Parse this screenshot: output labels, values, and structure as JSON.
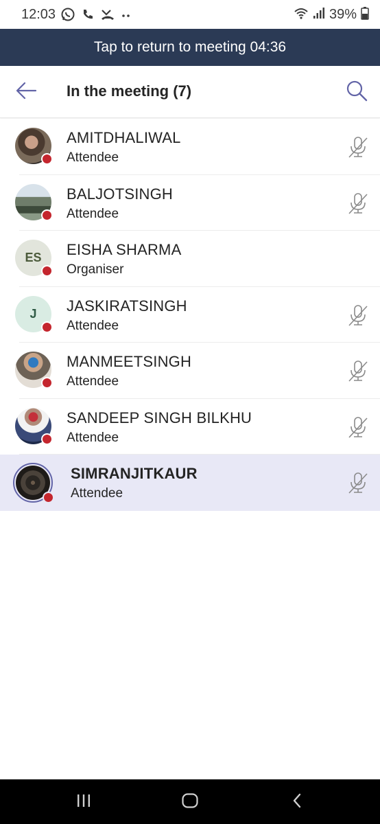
{
  "status_bar": {
    "time": "12:03",
    "battery": "39%",
    "icons_left": [
      "whatsapp-icon",
      "phone-icon",
      "missed-call-icon",
      "more-dots-icon"
    ],
    "icons_right": [
      "wifi-icon",
      "signal-icon",
      "battery-icon"
    ]
  },
  "banner": {
    "text": "Tap to return to meeting 04:36"
  },
  "header": {
    "title": "In the meeting (7)",
    "back_icon": "back-arrow-icon",
    "search_icon": "search-icon"
  },
  "colors": {
    "banner_bg": "#2b3a55",
    "accent": "#6264a7",
    "presence_busy": "#c4262e",
    "selected_row": "#e8e8f6"
  },
  "participants": [
    {
      "name": "AMITDHALIWAL",
      "role": "Attendee",
      "avatar": "photo",
      "muted": true
    },
    {
      "name": "BALJOTSINGH",
      "role": "Attendee",
      "avatar": "photo",
      "muted": true
    },
    {
      "name": "EISHA SHARMA",
      "role": "Organiser",
      "avatar": "initials",
      "initials": "ES",
      "muted": false
    },
    {
      "name": "JASKIRATSINGH",
      "role": "Attendee",
      "avatar": "initials",
      "initials": "J",
      "muted": true
    },
    {
      "name": "MANMEETSINGH",
      "role": "Attendee",
      "avatar": "photo",
      "muted": true
    },
    {
      "name": "SANDEEP SINGH BILKHU",
      "role": "Attendee",
      "avatar": "photo",
      "muted": true
    },
    {
      "name": "SIMRANJITKAUR",
      "role": "Attendee",
      "avatar": "photo",
      "muted": true,
      "selected": true
    }
  ],
  "nav_bar": {
    "icons": [
      "recent-apps-icon",
      "home-icon",
      "back-icon"
    ]
  }
}
